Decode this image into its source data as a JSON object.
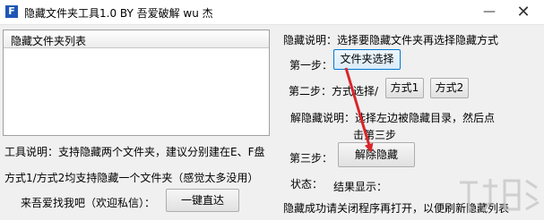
{
  "window": {
    "title": "隐藏文件夹工具1.0 BY 吾爱破解 wu 杰",
    "icon_letter": "F",
    "minimize_symbol": "—",
    "close_symbol": "✕"
  },
  "list": {
    "header": "隐藏文件夹列表"
  },
  "left_info": {
    "tool_desc": "工具说明：支持隐藏两个文件夹，建议分别建在E、F盘",
    "mode_desc": "方式1/方式2均支持隐藏一个文件夹（感觉太多没用）",
    "contact_label": "来吾爱找我吧（欢迎私信）：",
    "direct_button": "一键直达"
  },
  "right_panel": {
    "hide_desc": "隐藏说明：选择要隐藏文件夹再选择隐藏方式",
    "step1_label": "第一步：",
    "folder_select_button": "文件夹选择",
    "step2_label": "第二步：方式选择/",
    "method1_button": "方式1",
    "method2_button": "方式2",
    "unhide_desc_line1": "解隐藏说明：选择左边被隐藏目录，然后点",
    "unhide_desc_line2": "击第三步",
    "step3_label": "第三步：",
    "unhide_button": "解除隐藏",
    "status_label": "状态：",
    "result_label": "结果显示：",
    "result_text": "隐藏成功请关闭程序再打开，以便刷新隐藏列表"
  },
  "colors": {
    "arrow": "#d9262b",
    "focus_border": "#0078d7",
    "icon_bg": "#1f57b6"
  }
}
